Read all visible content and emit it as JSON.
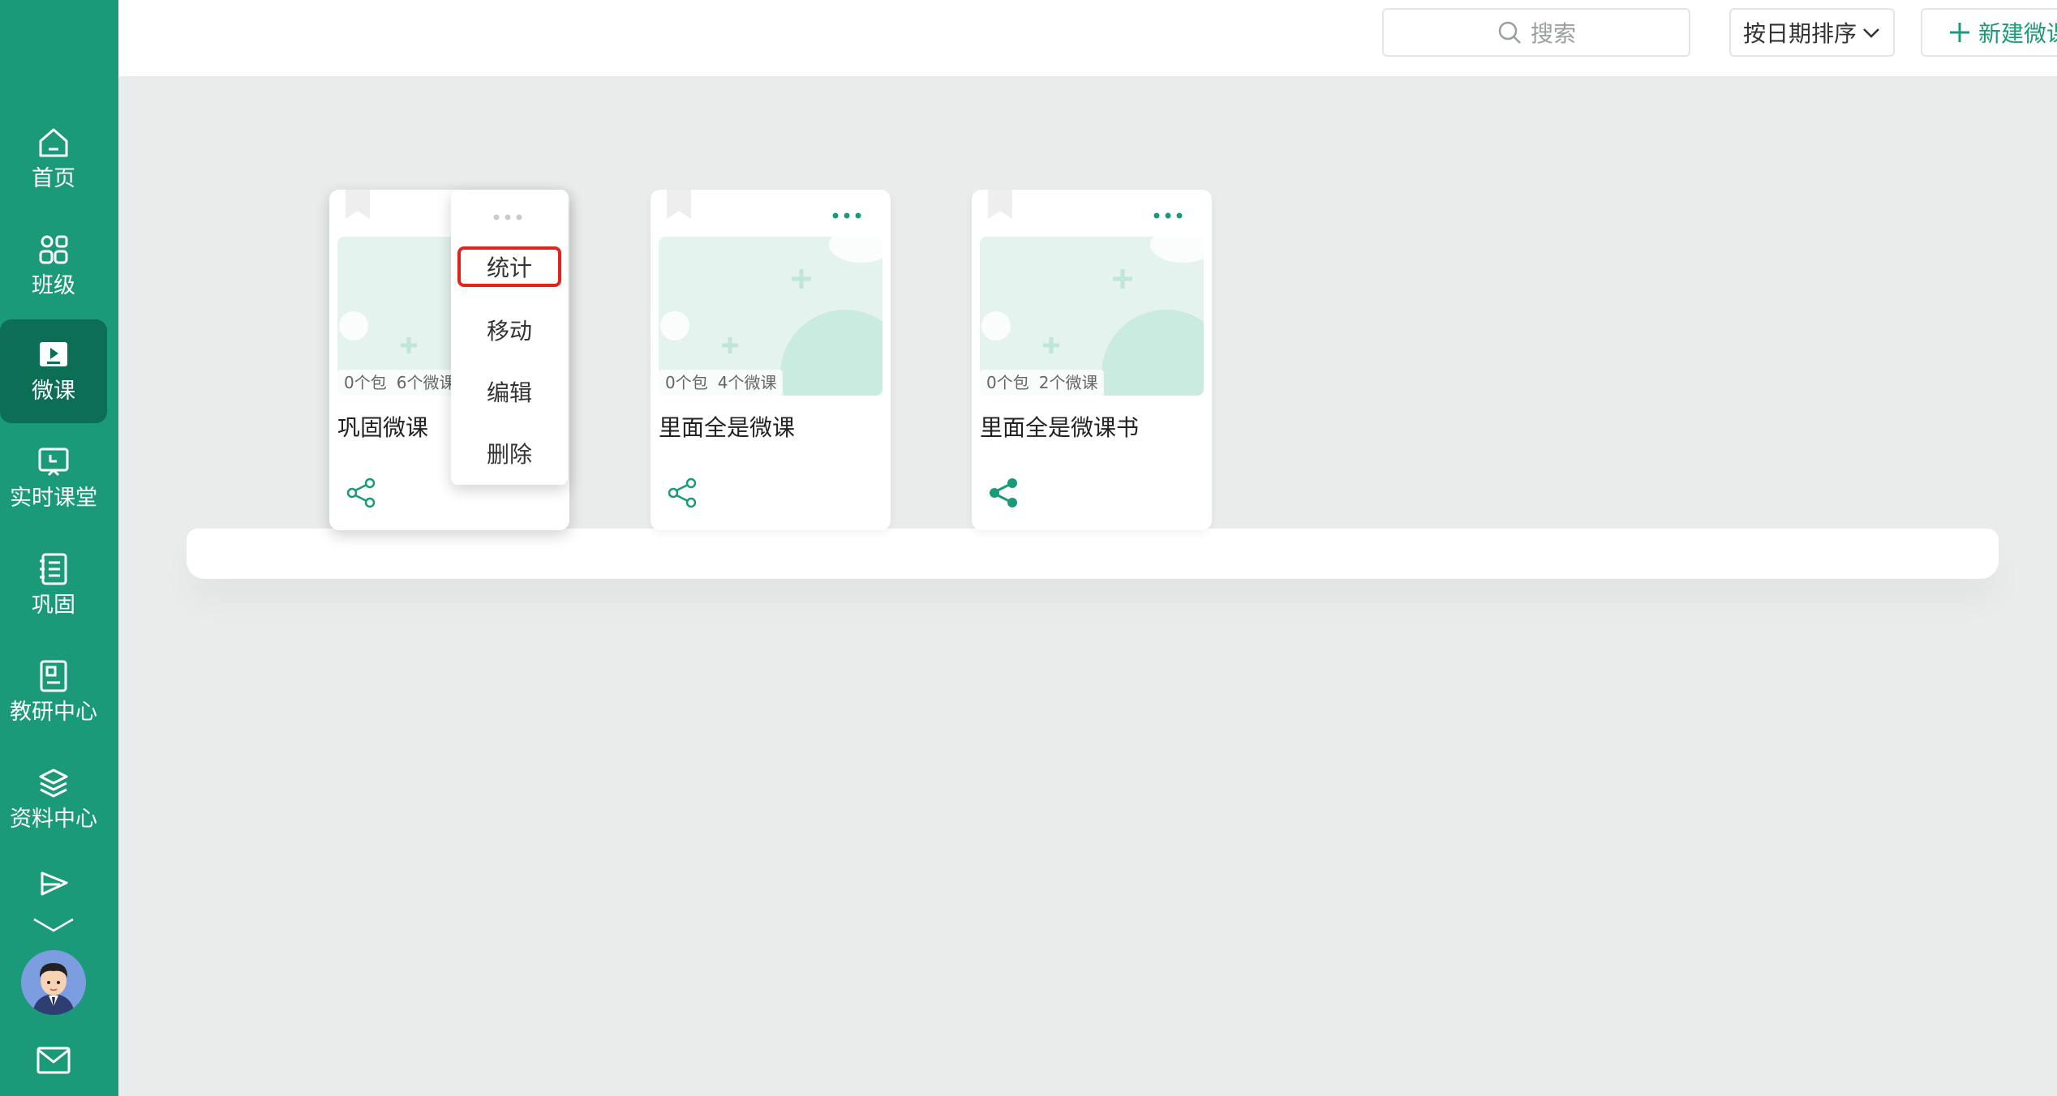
{
  "sidebar": {
    "items": [
      {
        "label": "首页",
        "icon": "home-icon"
      },
      {
        "label": "班级",
        "icon": "class-icon"
      },
      {
        "label": "微课",
        "icon": "micro-lesson-icon",
        "active": true
      },
      {
        "label": "实时课堂",
        "icon": "live-classroom-icon"
      },
      {
        "label": "巩固",
        "icon": "consolidate-icon"
      },
      {
        "label": "教研中心",
        "icon": "research-icon"
      },
      {
        "label": "资料中心",
        "icon": "layers-icon"
      },
      {
        "label": "",
        "icon": "send-icon"
      }
    ]
  },
  "topbar": {
    "search_placeholder": "搜索",
    "sort_label": "按日期排序",
    "new_button_label": "新建微课包"
  },
  "cards": [
    {
      "title": "巩固微课",
      "packages": "0个包",
      "lessons": "6个微课"
    },
    {
      "title": "里面全是微课",
      "packages": "0个包",
      "lessons": "4个微课"
    },
    {
      "title": "里面全是微课书",
      "packages": "0个包",
      "lessons": "2个微课"
    }
  ],
  "context_menu": {
    "items": [
      "统计",
      "移动",
      "编辑",
      "删除"
    ],
    "highlighted": "统计"
  },
  "colors": {
    "sidebar": "#1a9a78",
    "sidebar_active": "#0d6e56",
    "accent": "#1a9a78",
    "highlight_border": "#e0261a",
    "background": "#e9ecea"
  }
}
